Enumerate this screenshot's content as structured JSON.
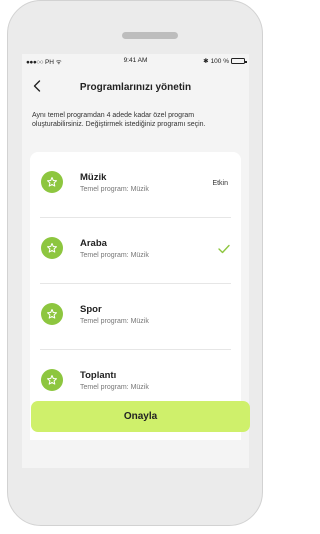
{
  "status_bar": {
    "carrier": "PH",
    "time": "9:41 AM",
    "bluetooth": "✱",
    "battery": "100 %"
  },
  "header": {
    "title": "Programlarınızı yönetin"
  },
  "description": "Aynı temel programdan 4 adede kadar özel program oluşturabilirsiniz. Değiştirmek istediğiniz programı seçin.",
  "programs": [
    {
      "name": "Müzik",
      "subtitle": "Temel program: Müzik",
      "status": "Etkin",
      "selected": false
    },
    {
      "name": "Araba",
      "subtitle": "Temel program: Müzik",
      "status": "",
      "selected": true
    },
    {
      "name": "Spor",
      "subtitle": "Temel program: Müzik",
      "status": "",
      "selected": false
    },
    {
      "name": "Toplantı",
      "subtitle": "Temel program: Müzik",
      "status": "",
      "selected": false
    }
  ],
  "confirm_label": "Onayla",
  "colors": {
    "accent": "#8dc63f",
    "button": "#cff06b",
    "background": "#f4f4f4"
  },
  "icons": {
    "back": "chevron-left-icon",
    "program": "star-icon",
    "selected": "checkmark-icon"
  }
}
